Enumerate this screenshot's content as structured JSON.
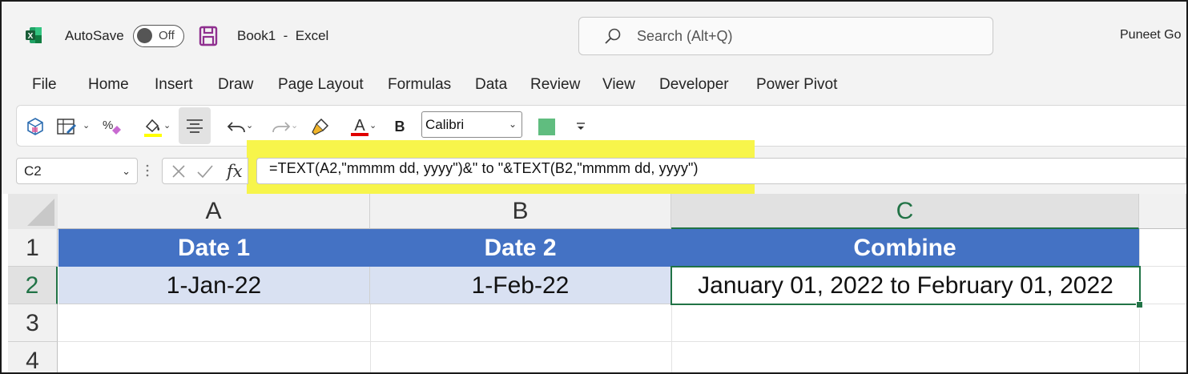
{
  "titlebar": {
    "autosave_label": "AutoSave",
    "autosave_state": "Off",
    "document_title": "Book1  -  Excel",
    "search_placeholder": "Search (Alt+Q)",
    "user_name": "Puneet Go"
  },
  "menu": {
    "items": [
      "File",
      "Home",
      "Insert",
      "Draw",
      "Page Layout",
      "Formulas",
      "Data",
      "Review",
      "View",
      "Developer",
      "Power Pivot"
    ]
  },
  "toolbar": {
    "font_name": "Calibri",
    "bold_label": "B",
    "font_color": "#e00000",
    "highlight_color": "#ffff00",
    "fill_swatch_color": "#60bd7f"
  },
  "formula_bar": {
    "name_box": "C2",
    "fx_label": "fx",
    "formula": "=TEXT(A2,\"mmmm dd, yyyy\")&\" to \"&TEXT(B2,\"mmmm dd, yyyy\")"
  },
  "sheet": {
    "columns": [
      "A",
      "B",
      "C"
    ],
    "rows": [
      "1",
      "2",
      "3",
      "4"
    ],
    "header_row": [
      "Date 1",
      "Date 2",
      "Combine"
    ],
    "data_row": [
      "1-Jan-22",
      "1-Feb-22",
      "January 01, 2022 to February 01, 2022"
    ],
    "active_cell": "C2",
    "header_color": "#4472c4",
    "data_fill_color": "#d9e1f2",
    "selection_color": "#217346"
  }
}
